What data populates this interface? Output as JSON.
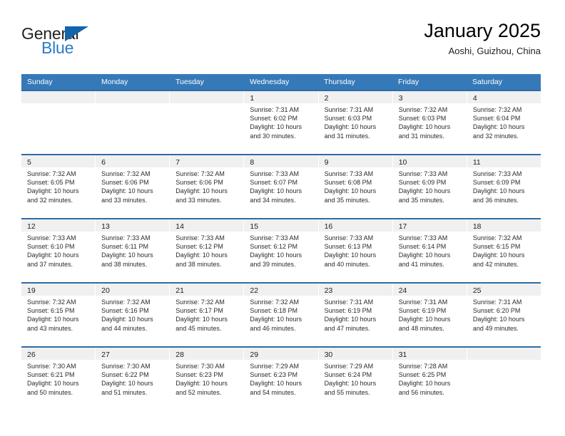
{
  "brand": {
    "word1": "General",
    "word2": "Blue",
    "triangle_color": "#1464ab",
    "blue_text_color": "#2a7cc7"
  },
  "header": {
    "title": "January 2025",
    "subtitle": "Aoshi, Guizhou, China"
  },
  "theme": {
    "header_bar_color": "#3579b8",
    "row_divider_color": "#2d6ca6",
    "daynum_band_color": "#f0f0f0"
  },
  "weekdays": [
    "Sunday",
    "Monday",
    "Tuesday",
    "Wednesday",
    "Thursday",
    "Friday",
    "Saturday"
  ],
  "weeks": [
    [
      {
        "day": "",
        "sunrise": "",
        "sunset": "",
        "daylight_line1": "",
        "daylight_line2": "",
        "empty": true
      },
      {
        "day": "",
        "sunrise": "",
        "sunset": "",
        "daylight_line1": "",
        "daylight_line2": "",
        "empty": true
      },
      {
        "day": "",
        "sunrise": "",
        "sunset": "",
        "daylight_line1": "",
        "daylight_line2": "",
        "empty": true
      },
      {
        "day": "1",
        "sunrise": "Sunrise: 7:31 AM",
        "sunset": "Sunset: 6:02 PM",
        "daylight_line1": "Daylight: 10 hours",
        "daylight_line2": "and 30 minutes.",
        "empty": false
      },
      {
        "day": "2",
        "sunrise": "Sunrise: 7:31 AM",
        "sunset": "Sunset: 6:03 PM",
        "daylight_line1": "Daylight: 10 hours",
        "daylight_line2": "and 31 minutes.",
        "empty": false
      },
      {
        "day": "3",
        "sunrise": "Sunrise: 7:32 AM",
        "sunset": "Sunset: 6:03 PM",
        "daylight_line1": "Daylight: 10 hours",
        "daylight_line2": "and 31 minutes.",
        "empty": false
      },
      {
        "day": "4",
        "sunrise": "Sunrise: 7:32 AM",
        "sunset": "Sunset: 6:04 PM",
        "daylight_line1": "Daylight: 10 hours",
        "daylight_line2": "and 32 minutes.",
        "empty": false
      }
    ],
    [
      {
        "day": "5",
        "sunrise": "Sunrise: 7:32 AM",
        "sunset": "Sunset: 6:05 PM",
        "daylight_line1": "Daylight: 10 hours",
        "daylight_line2": "and 32 minutes.",
        "empty": false
      },
      {
        "day": "6",
        "sunrise": "Sunrise: 7:32 AM",
        "sunset": "Sunset: 6:06 PM",
        "daylight_line1": "Daylight: 10 hours",
        "daylight_line2": "and 33 minutes.",
        "empty": false
      },
      {
        "day": "7",
        "sunrise": "Sunrise: 7:32 AM",
        "sunset": "Sunset: 6:06 PM",
        "daylight_line1": "Daylight: 10 hours",
        "daylight_line2": "and 33 minutes.",
        "empty": false
      },
      {
        "day": "8",
        "sunrise": "Sunrise: 7:33 AM",
        "sunset": "Sunset: 6:07 PM",
        "daylight_line1": "Daylight: 10 hours",
        "daylight_line2": "and 34 minutes.",
        "empty": false
      },
      {
        "day": "9",
        "sunrise": "Sunrise: 7:33 AM",
        "sunset": "Sunset: 6:08 PM",
        "daylight_line1": "Daylight: 10 hours",
        "daylight_line2": "and 35 minutes.",
        "empty": false
      },
      {
        "day": "10",
        "sunrise": "Sunrise: 7:33 AM",
        "sunset": "Sunset: 6:09 PM",
        "daylight_line1": "Daylight: 10 hours",
        "daylight_line2": "and 35 minutes.",
        "empty": false
      },
      {
        "day": "11",
        "sunrise": "Sunrise: 7:33 AM",
        "sunset": "Sunset: 6:09 PM",
        "daylight_line1": "Daylight: 10 hours",
        "daylight_line2": "and 36 minutes.",
        "empty": false
      }
    ],
    [
      {
        "day": "12",
        "sunrise": "Sunrise: 7:33 AM",
        "sunset": "Sunset: 6:10 PM",
        "daylight_line1": "Daylight: 10 hours",
        "daylight_line2": "and 37 minutes.",
        "empty": false
      },
      {
        "day": "13",
        "sunrise": "Sunrise: 7:33 AM",
        "sunset": "Sunset: 6:11 PM",
        "daylight_line1": "Daylight: 10 hours",
        "daylight_line2": "and 38 minutes.",
        "empty": false
      },
      {
        "day": "14",
        "sunrise": "Sunrise: 7:33 AM",
        "sunset": "Sunset: 6:12 PM",
        "daylight_line1": "Daylight: 10 hours",
        "daylight_line2": "and 38 minutes.",
        "empty": false
      },
      {
        "day": "15",
        "sunrise": "Sunrise: 7:33 AM",
        "sunset": "Sunset: 6:12 PM",
        "daylight_line1": "Daylight: 10 hours",
        "daylight_line2": "and 39 minutes.",
        "empty": false
      },
      {
        "day": "16",
        "sunrise": "Sunrise: 7:33 AM",
        "sunset": "Sunset: 6:13 PM",
        "daylight_line1": "Daylight: 10 hours",
        "daylight_line2": "and 40 minutes.",
        "empty": false
      },
      {
        "day": "17",
        "sunrise": "Sunrise: 7:33 AM",
        "sunset": "Sunset: 6:14 PM",
        "daylight_line1": "Daylight: 10 hours",
        "daylight_line2": "and 41 minutes.",
        "empty": false
      },
      {
        "day": "18",
        "sunrise": "Sunrise: 7:32 AM",
        "sunset": "Sunset: 6:15 PM",
        "daylight_line1": "Daylight: 10 hours",
        "daylight_line2": "and 42 minutes.",
        "empty": false
      }
    ],
    [
      {
        "day": "19",
        "sunrise": "Sunrise: 7:32 AM",
        "sunset": "Sunset: 6:15 PM",
        "daylight_line1": "Daylight: 10 hours",
        "daylight_line2": "and 43 minutes.",
        "empty": false
      },
      {
        "day": "20",
        "sunrise": "Sunrise: 7:32 AM",
        "sunset": "Sunset: 6:16 PM",
        "daylight_line1": "Daylight: 10 hours",
        "daylight_line2": "and 44 minutes.",
        "empty": false
      },
      {
        "day": "21",
        "sunrise": "Sunrise: 7:32 AM",
        "sunset": "Sunset: 6:17 PM",
        "daylight_line1": "Daylight: 10 hours",
        "daylight_line2": "and 45 minutes.",
        "empty": false
      },
      {
        "day": "22",
        "sunrise": "Sunrise: 7:32 AM",
        "sunset": "Sunset: 6:18 PM",
        "daylight_line1": "Daylight: 10 hours",
        "daylight_line2": "and 46 minutes.",
        "empty": false
      },
      {
        "day": "23",
        "sunrise": "Sunrise: 7:31 AM",
        "sunset": "Sunset: 6:19 PM",
        "daylight_line1": "Daylight: 10 hours",
        "daylight_line2": "and 47 minutes.",
        "empty": false
      },
      {
        "day": "24",
        "sunrise": "Sunrise: 7:31 AM",
        "sunset": "Sunset: 6:19 PM",
        "daylight_line1": "Daylight: 10 hours",
        "daylight_line2": "and 48 minutes.",
        "empty": false
      },
      {
        "day": "25",
        "sunrise": "Sunrise: 7:31 AM",
        "sunset": "Sunset: 6:20 PM",
        "daylight_line1": "Daylight: 10 hours",
        "daylight_line2": "and 49 minutes.",
        "empty": false
      }
    ],
    [
      {
        "day": "26",
        "sunrise": "Sunrise: 7:30 AM",
        "sunset": "Sunset: 6:21 PM",
        "daylight_line1": "Daylight: 10 hours",
        "daylight_line2": "and 50 minutes.",
        "empty": false
      },
      {
        "day": "27",
        "sunrise": "Sunrise: 7:30 AM",
        "sunset": "Sunset: 6:22 PM",
        "daylight_line1": "Daylight: 10 hours",
        "daylight_line2": "and 51 minutes.",
        "empty": false
      },
      {
        "day": "28",
        "sunrise": "Sunrise: 7:30 AM",
        "sunset": "Sunset: 6:23 PM",
        "daylight_line1": "Daylight: 10 hours",
        "daylight_line2": "and 52 minutes.",
        "empty": false
      },
      {
        "day": "29",
        "sunrise": "Sunrise: 7:29 AM",
        "sunset": "Sunset: 6:23 PM",
        "daylight_line1": "Daylight: 10 hours",
        "daylight_line2": "and 54 minutes.",
        "empty": false
      },
      {
        "day": "30",
        "sunrise": "Sunrise: 7:29 AM",
        "sunset": "Sunset: 6:24 PM",
        "daylight_line1": "Daylight: 10 hours",
        "daylight_line2": "and 55 minutes.",
        "empty": false
      },
      {
        "day": "31",
        "sunrise": "Sunrise: 7:28 AM",
        "sunset": "Sunset: 6:25 PM",
        "daylight_line1": "Daylight: 10 hours",
        "daylight_line2": "and 56 minutes.",
        "empty": false
      },
      {
        "day": "",
        "sunrise": "",
        "sunset": "",
        "daylight_line1": "",
        "daylight_line2": "",
        "empty": true
      }
    ]
  ]
}
